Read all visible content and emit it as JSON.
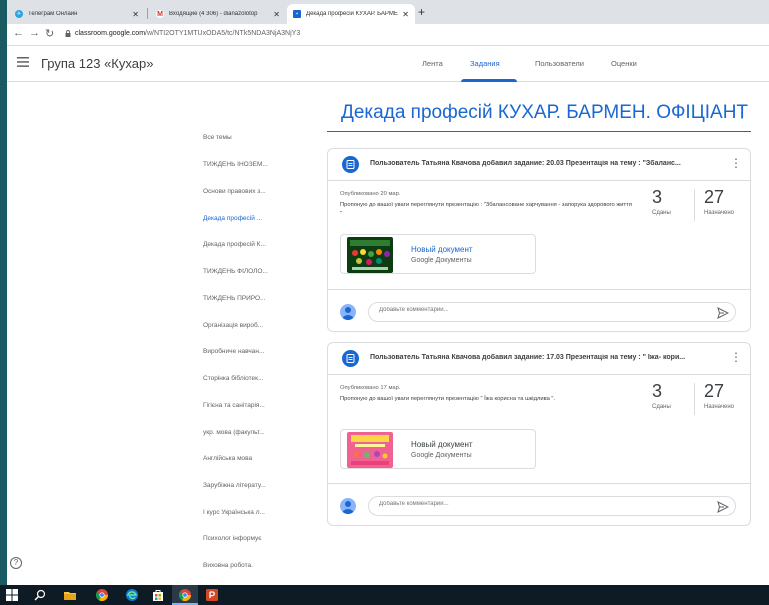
{
  "browser": {
    "tabs": [
      {
        "title": "Телеграм Онлайн"
      },
      {
        "title": "Входящие (4 306) - dianazolotop"
      },
      {
        "title": "Декада професій КУХАР. БАРМЕ"
      }
    ],
    "url_host": "classroom.google.com",
    "url_path": "/w/NTI2OTY1MTUxODA5/tc/NTk5NDA3NjA3NjY3"
  },
  "app": {
    "class_name": "Група 123 «Кухар»",
    "nav": [
      "Лента",
      "Задания",
      "Пользователи",
      "Оценки"
    ],
    "active_nav": 1
  },
  "topics": [
    "Все темы",
    "ТИЖДЕНЬ ІНОЗЕМ...",
    "Основи правових з...",
    "Декада професій ...",
    "Декада професій К...",
    "ТИЖДЕНЬ ФІЛОЛО...",
    "ТИЖДЕНЬ ПРИРО...",
    "Організація вироб...",
    "Виробниче навчан...",
    "Сторінка бібліотек...",
    "Гігієна та санітарія...",
    "укр. мова (факульт...",
    "Англійська мова",
    "Зарубіжна літерату...",
    "І курс Українська л...",
    "Психолог інформує",
    "Виховна робота."
  ],
  "active_topic": 3,
  "topic_title": "Декада професій КУХАР. БАРМЕН. ОФІЦІАНТ",
  "assignments": [
    {
      "title": "Пользователь Татьяна Квачова добавил задание: 20.03 Презентація на тему : \"Збаланс...",
      "posted": "Опубликовано 20 мар.",
      "description": "Пропоную до вашої уваги переглянути  презентацію : \"Збалансоване харчування - запорука здорового життя \"",
      "submitted": "3",
      "submitted_label": "Сданы",
      "assigned": "27",
      "assigned_label": "Назначено",
      "attachment_title": "Новый документ",
      "attachment_subtitle": "Google Документы",
      "comment_placeholder": "Добавьте комментарий..."
    },
    {
      "title": "Пользователь Татьяна Квачова добавил задание: 17.03 Презентація на тему : \" Їжа- кори...",
      "posted": "Опубликовано 17 мар.",
      "description": "Пропоную до вашої уваги переглянути  презентацію \" Їжа корисна та шкідлива \".",
      "submitted": "3",
      "submitted_label": "Сданы",
      "assigned": "27",
      "assigned_label": "Назначено",
      "attachment_title": "Новый документ",
      "attachment_subtitle": "Google Документы",
      "comment_placeholder": "Добавьте комментарий..."
    }
  ],
  "help_label": "?",
  "colors": {
    "accent": "#1967d2",
    "desktop": "#1a5a63",
    "taskbar": "#0f1b24"
  }
}
